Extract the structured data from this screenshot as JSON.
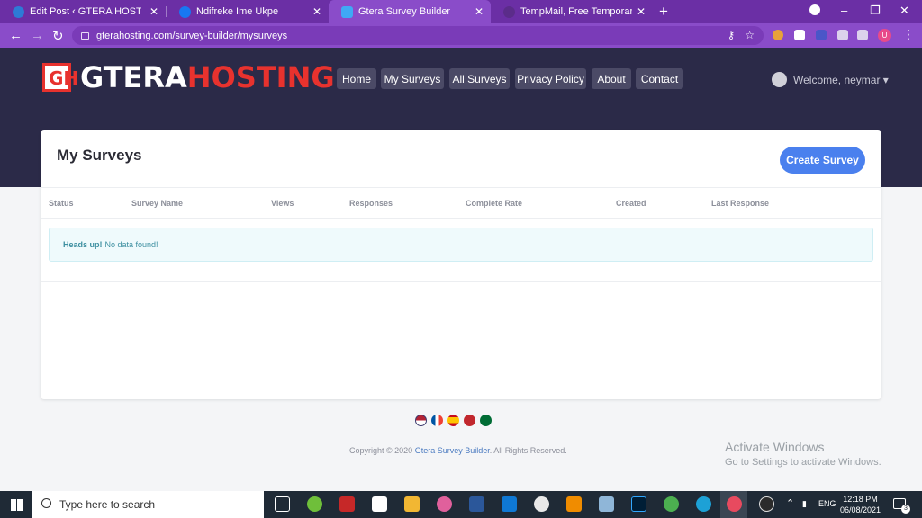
{
  "browser": {
    "tabs": [
      {
        "label": "Edit Post ‹ GTERA HOSTING — W",
        "icon": "wordpress-icon",
        "color": "#2e7ad6"
      },
      {
        "label": "Ndifreke Ime Ukpe",
        "icon": "facebook-icon",
        "color": "#1877f2"
      },
      {
        "label": "Gtera Survey Builder",
        "icon": "survey-builder-icon",
        "color": "#3fa9f5"
      },
      {
        "label": "TempMail, Free Temporary Mail A",
        "icon": "tempmail-icon",
        "color": "#5b2c8a"
      }
    ],
    "new_tab": "+",
    "url": "gterahosting.com/survey-builder/mysurveys",
    "profile_initial": "U"
  },
  "site": {
    "logo_mark": "GH",
    "logo_part1": "GTERA",
    "logo_part2": "HOSTING",
    "nav": [
      "Home",
      "My Surveys",
      "All Surveys",
      "Privacy Policy",
      "About",
      "Contact"
    ],
    "welcome": "Welcome, neymar ▾"
  },
  "main": {
    "title": "My Surveys",
    "create_button": "Create Survey",
    "columns": [
      "Status",
      "Survey Name",
      "Views",
      "Responses",
      "Complete Rate",
      "Created",
      "Last Response"
    ],
    "alert_strong": "Heads up!",
    "alert_text": "No data found!"
  },
  "footer": {
    "copyright_prefix": "Copyright © 2020",
    "copyright_brand": "Gtera Survey Builder",
    "copyright_suffix": ". All Rights Reserved.",
    "flags": [
      "us-flag",
      "france-flag",
      "spain-flag",
      "morocco-flag",
      "saudi-flag"
    ]
  },
  "windows": {
    "activate_title": "Activate Windows",
    "activate_text": "Go to Settings to activate Windows.",
    "search_placeholder": "Type here to search",
    "language": "ENG",
    "time": "12:18 PM",
    "date": "06/08/2021",
    "notifications": "3"
  }
}
